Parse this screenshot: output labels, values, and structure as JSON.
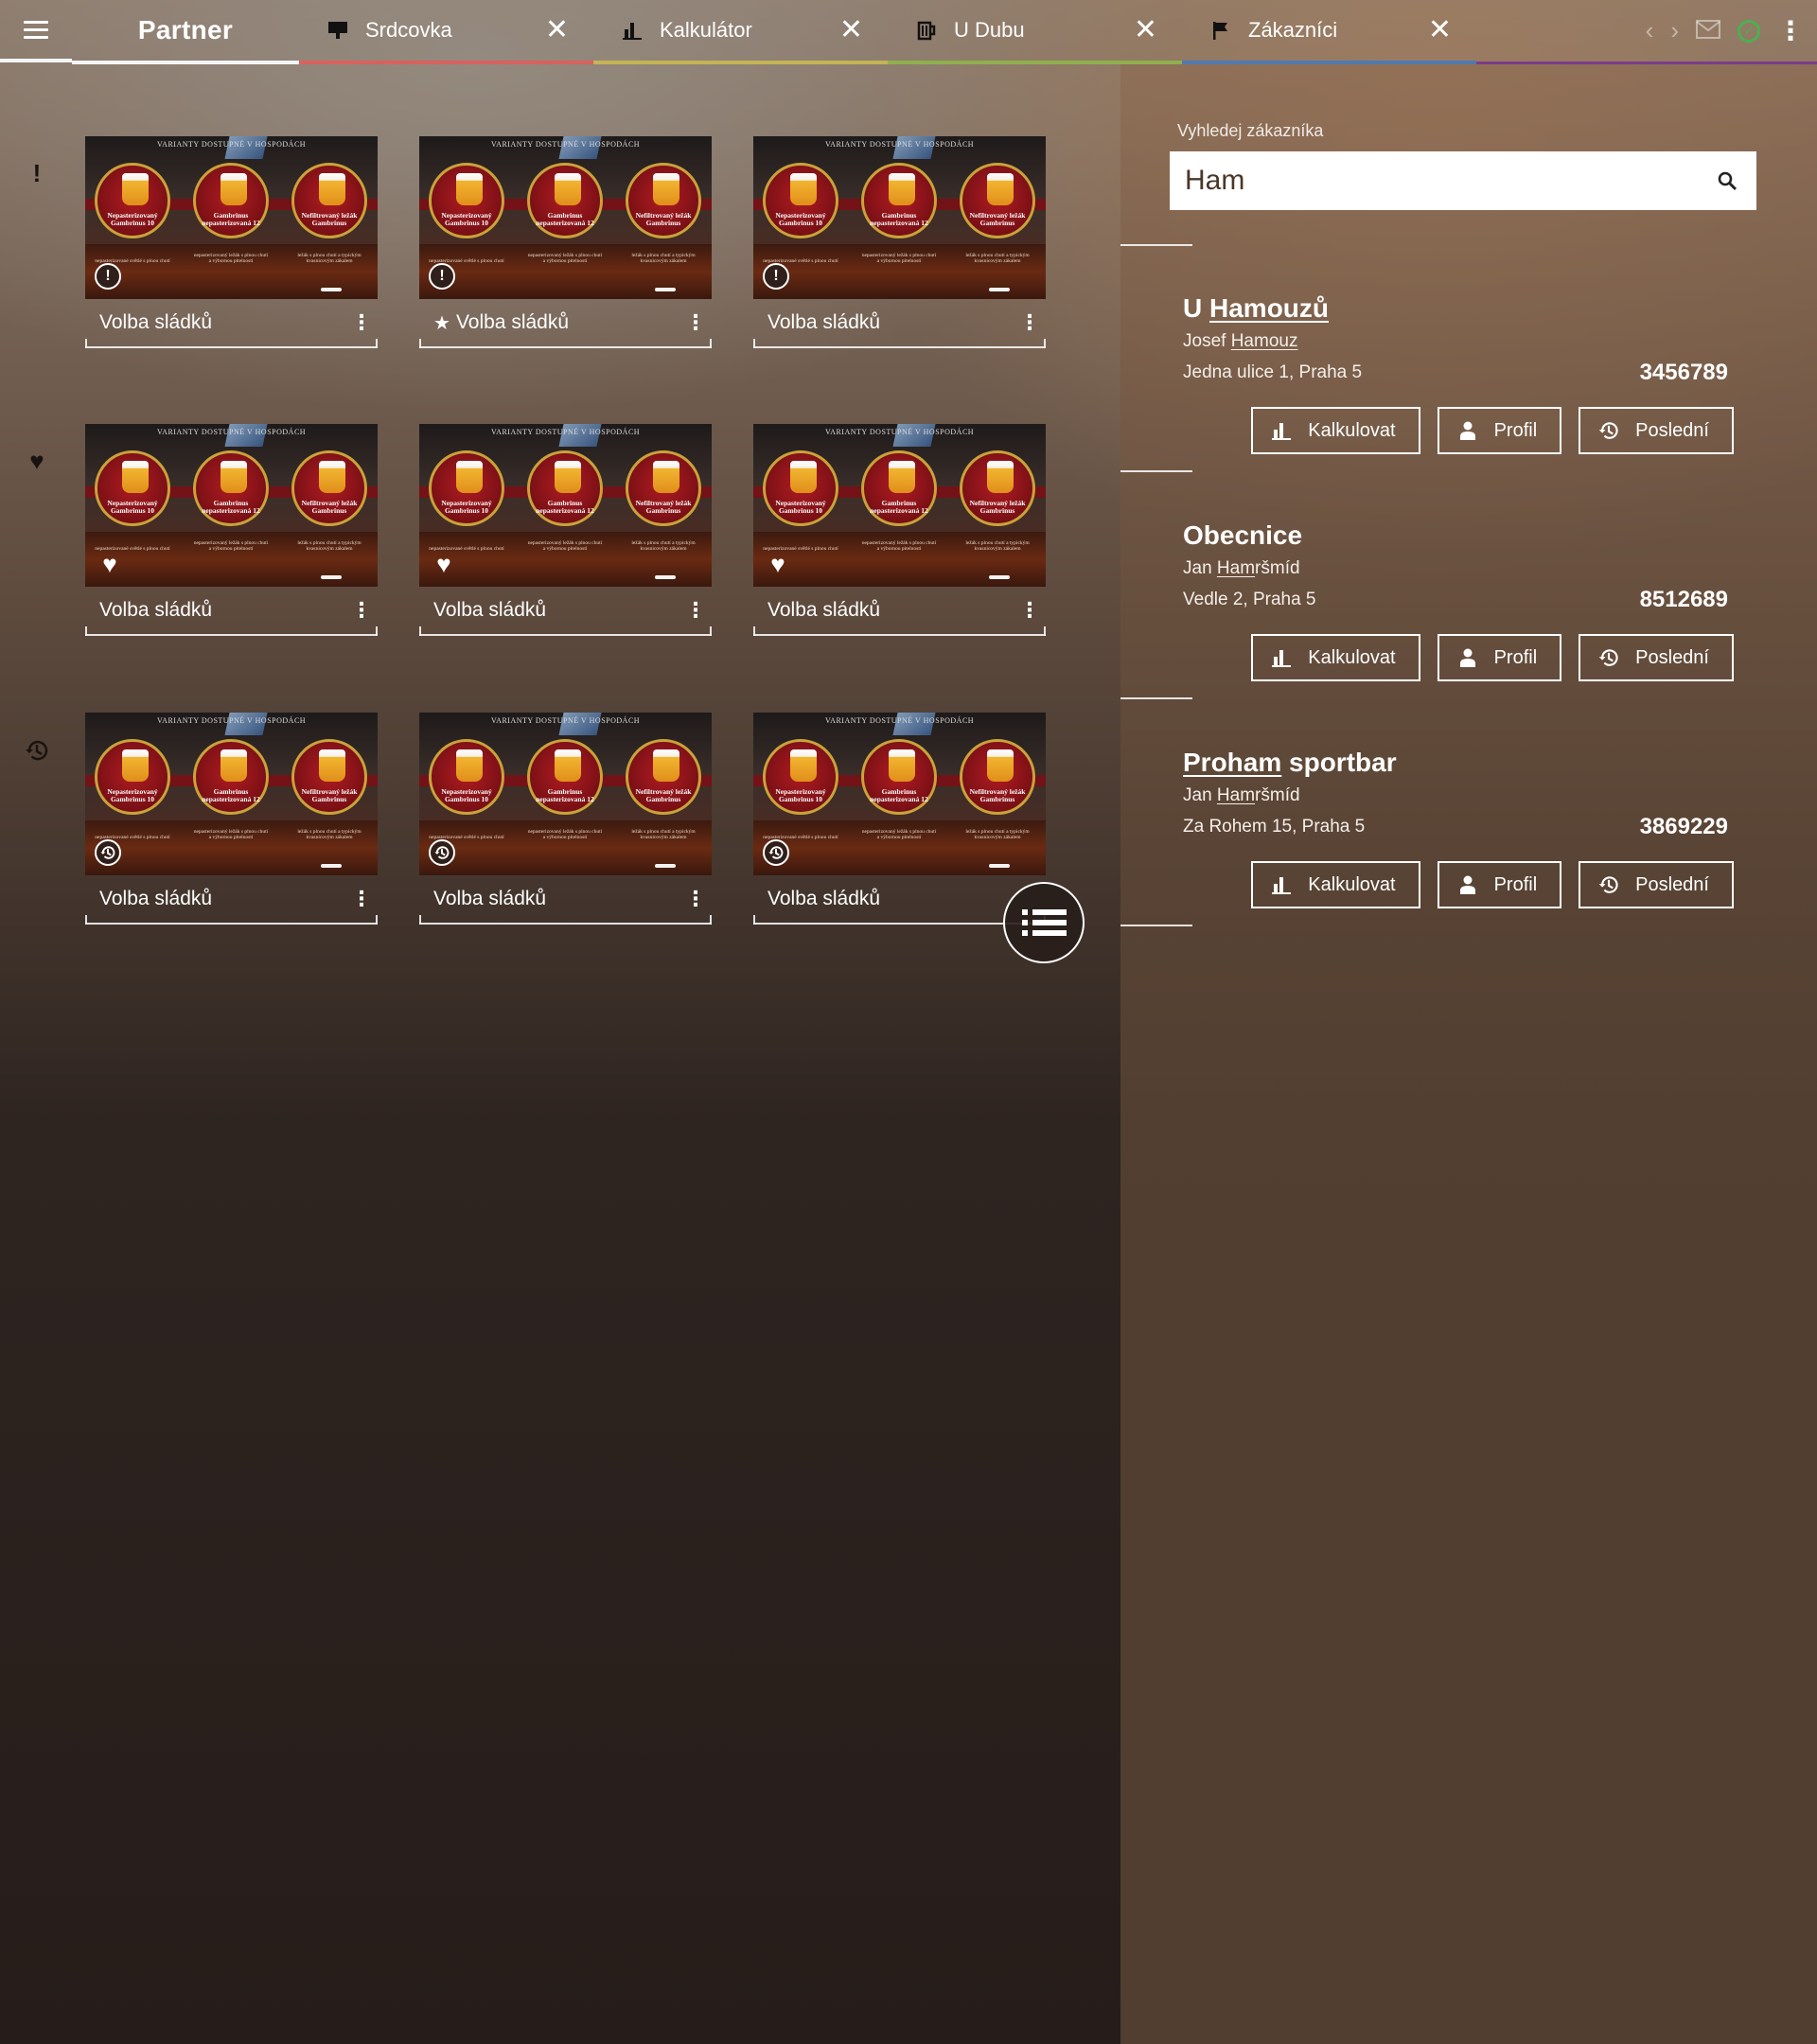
{
  "app": {
    "brand": "Partner"
  },
  "tabs": [
    {
      "label": "Srdcovka",
      "icon": "monitor-icon",
      "color": "#d9615e"
    },
    {
      "label": "Kalkulátor",
      "icon": "bar-chart-icon",
      "color": "#c5b454"
    },
    {
      "label": "U Dubu",
      "icon": "beer-mug-icon",
      "color": "#8fb04d"
    },
    {
      "label": "Zákazníci",
      "icon": "flag-icon",
      "color": "#4f7ab0"
    }
  ],
  "topbar_extra_color": "#7b3c8c",
  "cards": {
    "label": "Volba sládků",
    "thumb": {
      "banner": "VARIANTY DOSTUPNÉ V HOSPODÁCH",
      "beers": [
        {
          "name": "Nepasterizovaný Gambrinus 10",
          "desc": "nepasterizované světlé s plnou chutí"
        },
        {
          "name": "Gambrinus nepasterizovaná 12",
          "desc": "nepasterizovaný ležák s plnou chutí a výbornou pitelností"
        },
        {
          "name": "Nefiltrovaný ležák Gambrinus",
          "desc": "ležák s plnou chutí a typickým kvasnicovým zákalem"
        }
      ]
    },
    "rows": [
      {
        "section_icon": "exclamation-icon",
        "section_glyph": "!",
        "badge": "!",
        "items": [
          {
            "starred": false
          },
          {
            "starred": true
          },
          {
            "starred": false
          }
        ]
      },
      {
        "section_icon": "heart-icon",
        "section_glyph": "♥",
        "badge": "♥",
        "items": [
          {
            "starred": false
          },
          {
            "starred": false
          },
          {
            "starred": false
          }
        ]
      },
      {
        "section_icon": "history-icon",
        "section_glyph": "⟲",
        "badge": "⟲",
        "items": [
          {
            "starred": false
          },
          {
            "starred": false
          },
          {
            "starred": false
          }
        ]
      }
    ]
  },
  "search": {
    "label": "Vyhledej zákazníka",
    "value": "Ham"
  },
  "customers": [
    {
      "name_hl": "U Hamouzů",
      "name_pre": "U ",
      "name_match": "Hamouzů",
      "name_post": "",
      "contact_pre": "Josef ",
      "contact_match": "Hamouz",
      "contact_post": "",
      "address": "Jedna ulice 1, Praha 5",
      "number": "3456789"
    },
    {
      "name_pre": "Obecnice",
      "name_match": "",
      "name_post": "",
      "contact_pre": "Jan ",
      "contact_match": "Ham",
      "contact_post": "ršmíd",
      "address": "Vedle 2, Praha 5",
      "number": "8512689"
    },
    {
      "name_pre": "",
      "name_match": "Proham",
      "name_post": " sportbar",
      "contact_pre": "Jan ",
      "contact_match": "Ham",
      "contact_post": "ršmíd",
      "address": "Za Rohem 15, Praha 5",
      "number": "3869229"
    }
  ],
  "customer_buttons": {
    "calc": "Kalkulovat",
    "profile": "Profil",
    "last": "Poslední"
  }
}
